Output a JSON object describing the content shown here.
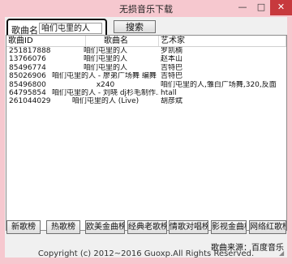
{
  "window": {
    "title": "无损音乐下载",
    "minimize_glyph": "—",
    "maximize_glyph": "□",
    "close_glyph": "✕"
  },
  "search": {
    "label": "歌曲名：",
    "value": "咱们屯里的人",
    "button_label": "搜索"
  },
  "table": {
    "columns": [
      "歌曲ID",
      "歌曲名",
      "艺术家"
    ],
    "rows": [
      {
        "id": "251817888",
        "name": "咱们屯里的人",
        "artist": "罗凯楠"
      },
      {
        "id": "13766076",
        "name": "咱们屯里的人",
        "artist": "赵本山"
      },
      {
        "id": "85496774",
        "name": "咱们屯里的人",
        "artist": "吉特巴"
      },
      {
        "id": "85026906",
        "name": "咱们屯里的人 - 廖弟广场舞 编舞 ...",
        "artist": "吉特巴"
      },
      {
        "id": "85496800",
        "name": "x240",
        "artist": "咱们屯里的人,雏白广场舞,320,反面"
      },
      {
        "id": "64795854",
        "name": "咱们屯里的人 - 刘晓 dj杉毛制作...",
        "artist": "htall"
      },
      {
        "id": "261044029",
        "name": "咱们屯里的人 (Live)",
        "artist": "胡彦斌"
      }
    ]
  },
  "bottom_buttons": [
    "新歌榜",
    "热歌榜",
    "欧美金曲榜",
    "经典老歌榜",
    "情歌对唱榜",
    "影视金曲榜",
    "网络红歌榜"
  ],
  "footer": {
    "source": "歌曲来源：百度音乐",
    "copyright": "Copyright (c)  2012~2016 Guoxp.All Rights Reserved."
  }
}
